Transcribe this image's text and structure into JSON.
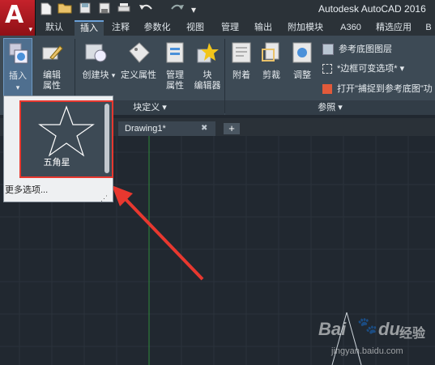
{
  "app": {
    "logo_letter": "A",
    "title": "Autodesk AutoCAD 2016"
  },
  "quick_access": [
    "new-icon",
    "open-icon",
    "save-icon",
    "saveas-icon",
    "print-icon",
    "undo-icon",
    "redo-icon",
    "dropdown-icon"
  ],
  "ribbon_tabs": [
    {
      "label": "默认",
      "active": false
    },
    {
      "label": "插入",
      "active": true
    },
    {
      "label": "注释",
      "active": false
    },
    {
      "label": "参数化",
      "active": false
    },
    {
      "label": "视图",
      "active": false
    },
    {
      "label": "管理",
      "active": false
    },
    {
      "label": "输出",
      "active": false
    },
    {
      "label": "附加模块",
      "active": false
    },
    {
      "label": "A360",
      "active": false
    },
    {
      "label": "精选应用",
      "active": false
    },
    {
      "label": "B",
      "active": false
    }
  ],
  "ribbon": {
    "insert": {
      "label": "插入"
    },
    "edit_attr": {
      "label_line1": "编辑",
      "label_line2": "属性"
    },
    "create_block": {
      "label": "创建块"
    },
    "define_attr": {
      "label": "定义属性"
    },
    "manage_attr": {
      "label_line1": "管理",
      "label_line2": "属性"
    },
    "block_editor": {
      "label_line1": "块",
      "label_line2": "编辑器"
    },
    "block_def_panel": {
      "label": "块定义"
    },
    "attach": {
      "label": "附着"
    },
    "clip": {
      "label": "剪裁"
    },
    "adjust": {
      "label": "调整"
    },
    "ref_underlay_layers": {
      "label": "参考底图图层"
    },
    "frame_variable": {
      "label": "*边框可变选项*"
    },
    "snap_underlay": {
      "label": "打开\"捕捉到参考底图\"功"
    },
    "reference_panel": {
      "label": "参照"
    }
  },
  "popup": {
    "block_name": "五角星",
    "more_options": "更多选项..."
  },
  "document": {
    "tab_title": "Drawing1*",
    "close_glyph": "✖",
    "new_tab_glyph": "+"
  },
  "watermark": {
    "brand": "Bai",
    "brand_suffix": "du",
    "cn": "经验",
    "url": "jingyan.baidu.com"
  },
  "colors": {
    "annotation_red": "#e8382f",
    "canvas_bg": "#212830",
    "ribbon_bg": "#3d4a55"
  }
}
